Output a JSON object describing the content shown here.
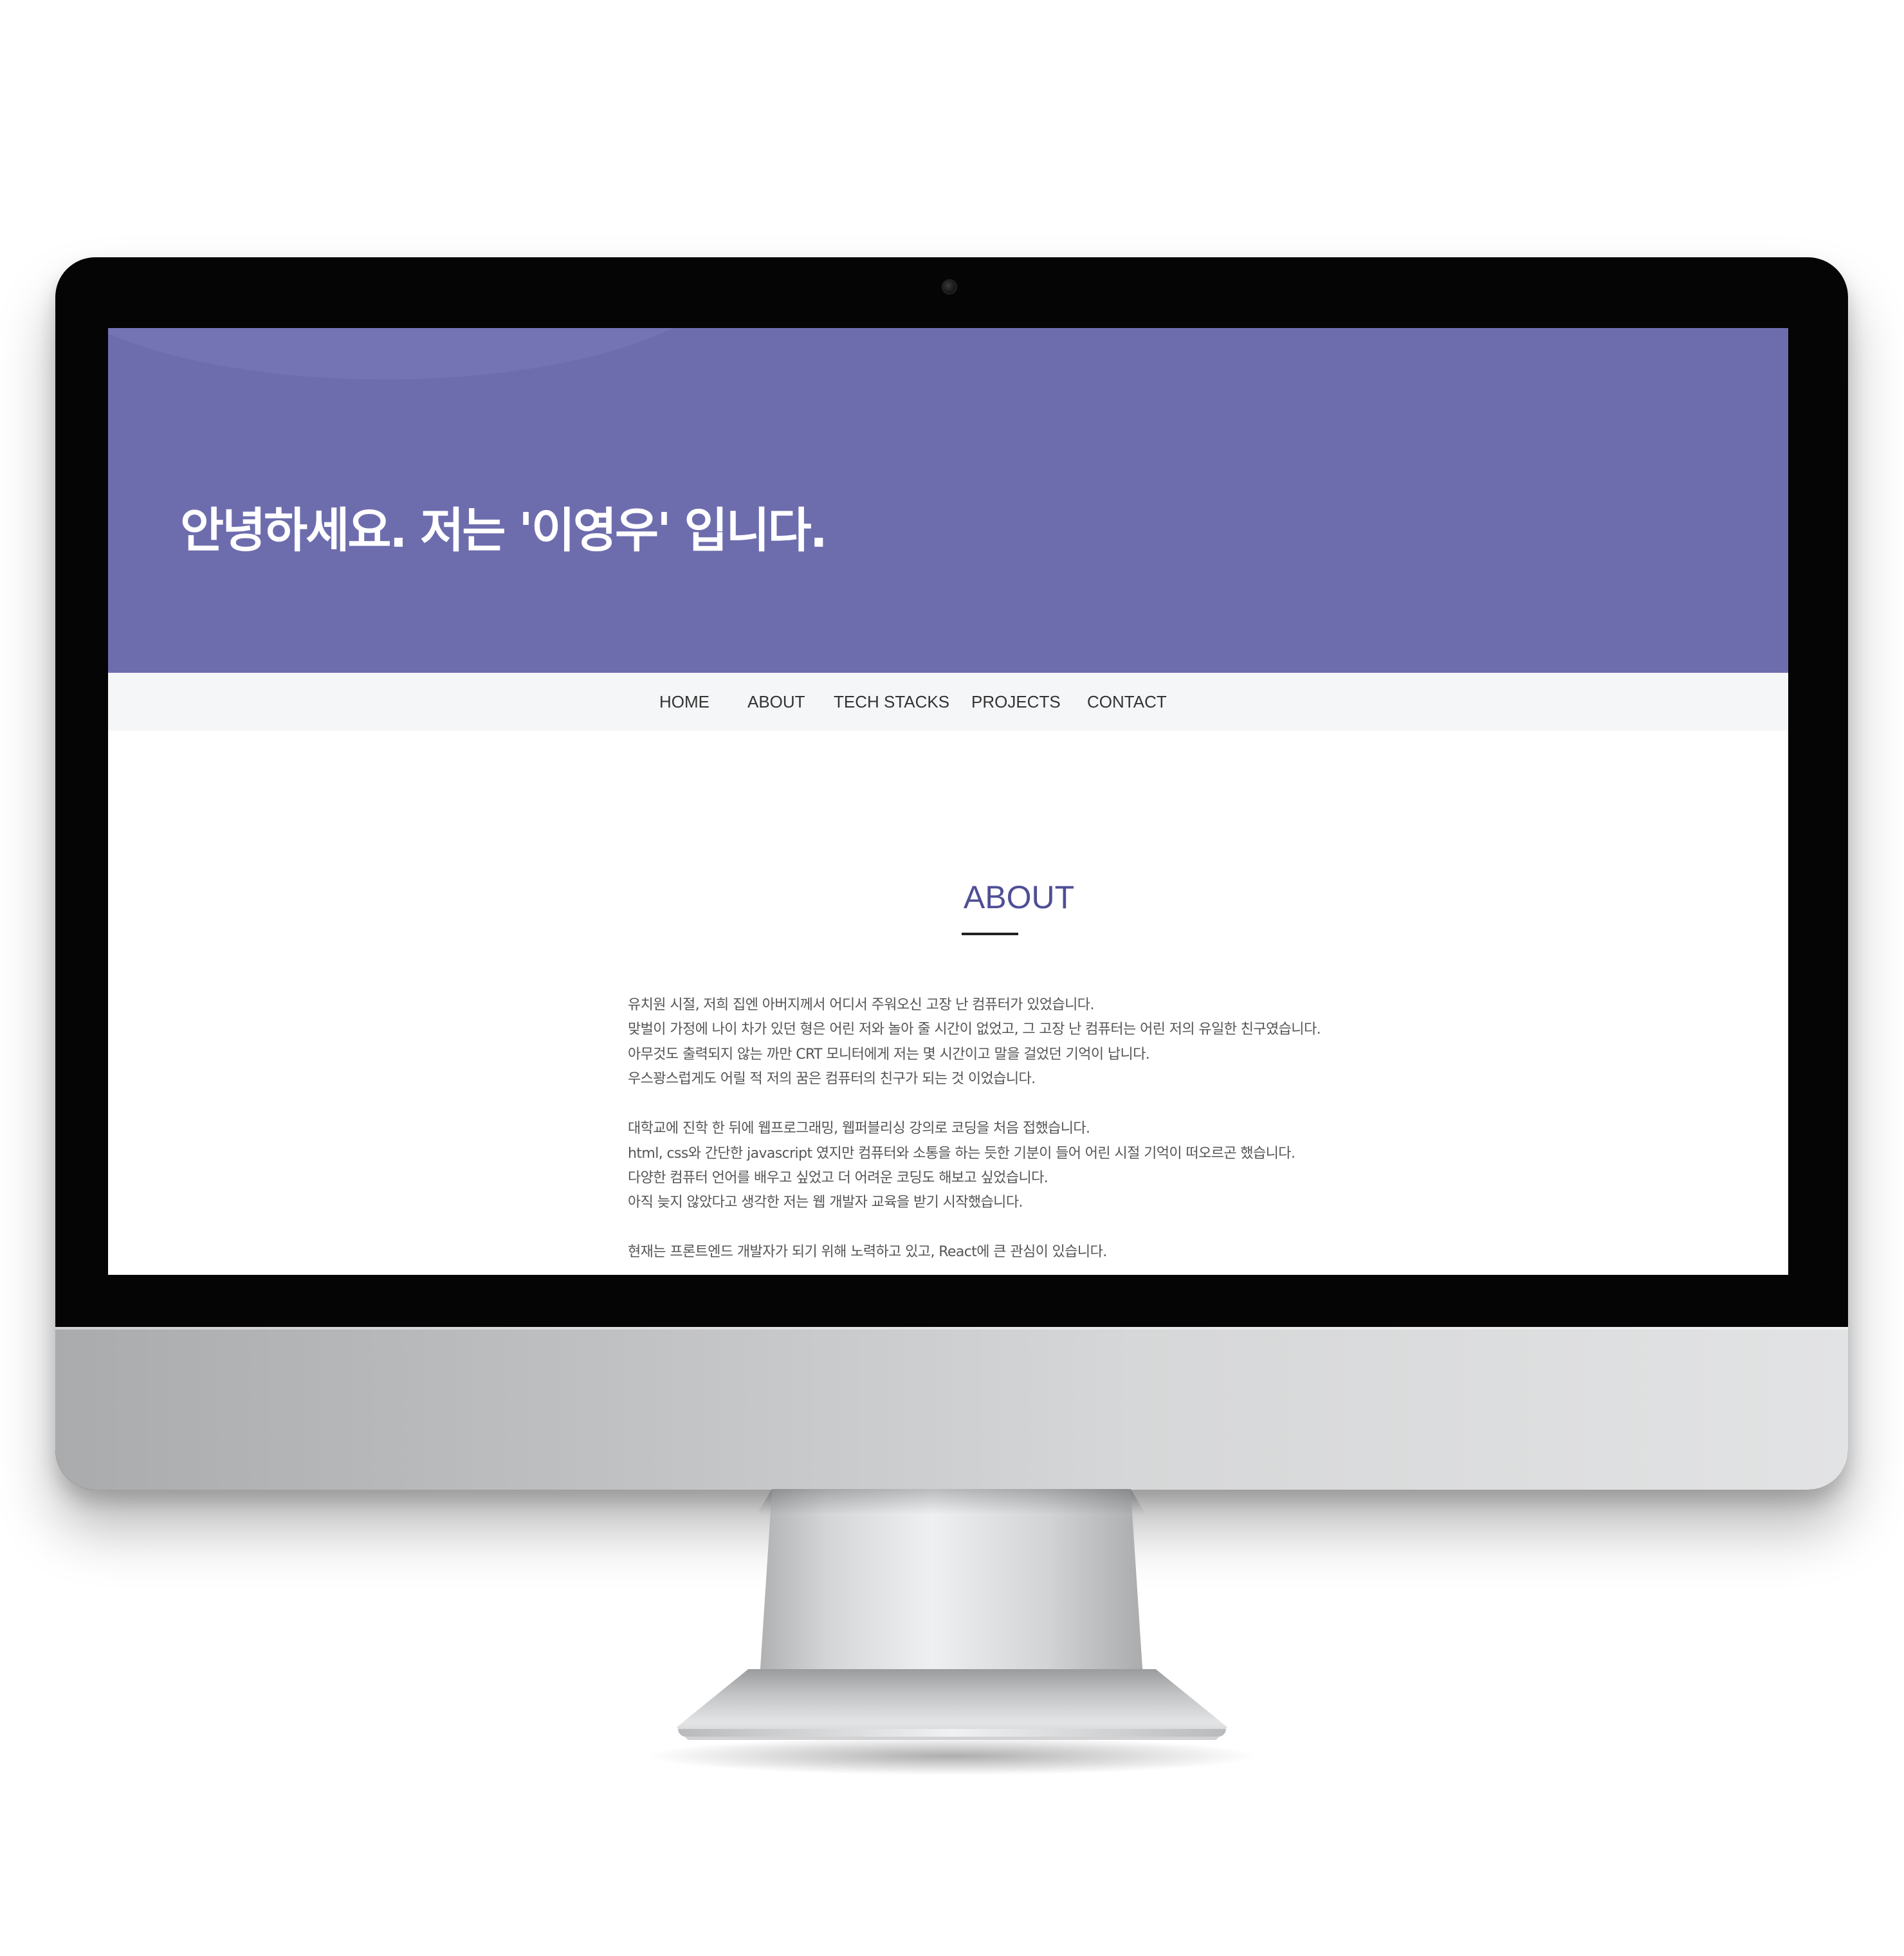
{
  "hero": {
    "title": "안녕하세요. 저는 '이영우' 입니다."
  },
  "nav": {
    "items": [
      "HOME",
      "ABOUT",
      "TECH STACKS",
      "PROJECTS",
      "CONTACT"
    ]
  },
  "about": {
    "title": "ABOUT",
    "paragraphs": [
      [
        "유치원 시절, 저희 집엔 아버지께서 어디서 주워오신 고장 난 컴퓨터가 있었습니다.",
        "맞벌이 가정에 나이 차가 있던 형은 어린 저와 놀아 줄 시간이 없었고, 그 고장 난 컴퓨터는 어린 저의 유일한 친구였습니다.",
        "아무것도 출력되지 않는 까만 CRT 모니터에게 저는 몇 시간이고 말을 걸었던 기억이 납니다.",
        "우스꽝스럽게도 어릴 적 저의 꿈은 컴퓨터의 친구가 되는 것 이었습니다."
      ],
      [
        "대학교에 진학 한 뒤에 웹프로그래밍, 웹퍼블리싱 강의로 코딩을 처음 접했습니다.",
        "html, css와 간단한 javascript 였지만 컴퓨터와 소통을 하는 듯한 기분이 들어 어린 시절 기억이 떠오르곤 했습니다.",
        "다양한 컴퓨터 언어를 배우고 싶었고 더 어려운 코딩도 해보고 싶었습니다.",
        "아직 늦지 않았다고 생각한 저는 웹 개발자 교육을 받기 시작했습니다."
      ],
      [
        "현재는 프론트엔드 개발자가 되기 위해 노력하고 있고, React에 큰 관심이 있습니다."
      ]
    ]
  },
  "colors": {
    "hero_bg": "#6d6dae",
    "accent": "#4f4f96",
    "nav_bg": "#f5f6f8"
  }
}
